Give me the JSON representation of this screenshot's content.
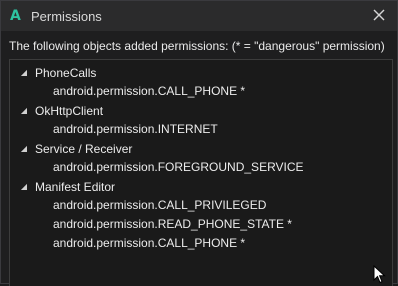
{
  "window": {
    "title": "Permissions",
    "logo_letter": "A"
  },
  "header": {
    "text": "The following objects added permissions: (* = \"dangerous\" permission)"
  },
  "tree": {
    "groups": [
      {
        "label": "PhoneCalls",
        "expand_glyph": "◢",
        "items": [
          "android.permission.CALL_PHONE *"
        ]
      },
      {
        "label": "OkHttpClient",
        "expand_glyph": "◢",
        "items": [
          "android.permission.INTERNET"
        ]
      },
      {
        "label": "Service / Receiver",
        "expand_glyph": "◢",
        "items": [
          "android.permission.FOREGROUND_SERVICE"
        ]
      },
      {
        "label": "Manifest Editor",
        "expand_glyph": "◢",
        "items": [
          "android.permission.CALL_PRIVILEGED",
          "android.permission.READ_PHONE_STATE *",
          "android.permission.CALL_PHONE *"
        ]
      }
    ]
  },
  "colors": {
    "accent": "#2ec2a0",
    "background": "#1e1e1f",
    "titlebar": "#2b2b2c"
  }
}
